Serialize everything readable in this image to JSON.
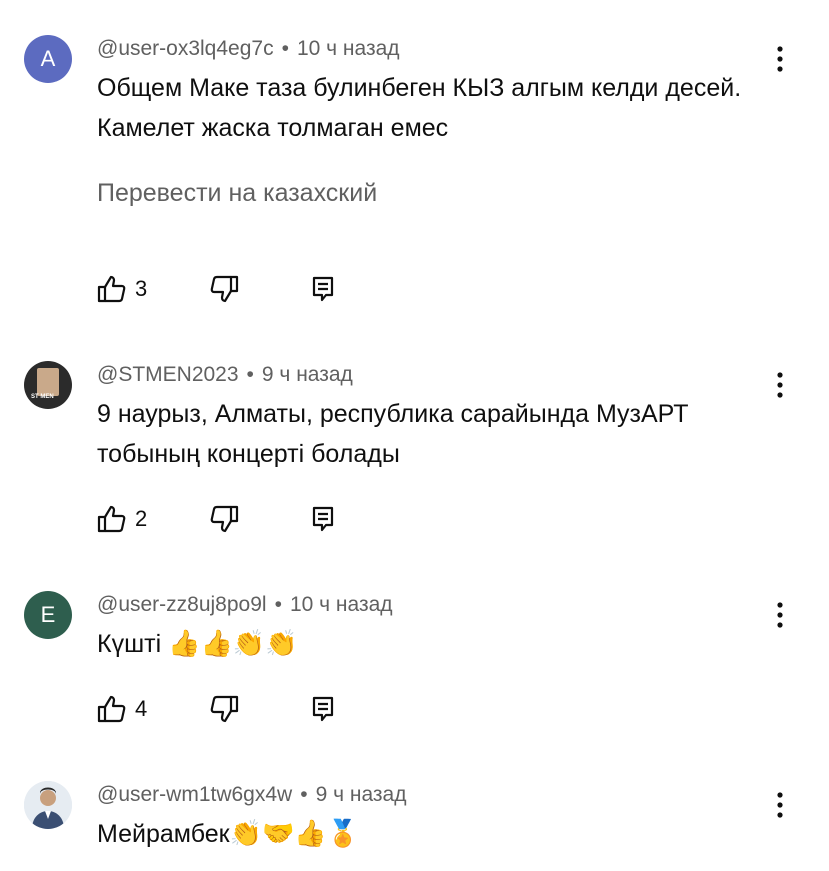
{
  "comments": [
    {
      "avatar_letter": "A",
      "avatar_color": "#5c6bc0",
      "author": "@user-ox3lq4eg7c",
      "time": "10 ч назад",
      "text": "Общем Маке таза булинбеген КЫЗ алгым келди десей. Камелет жаска толмаган емес",
      "translate": "Перевести на казахский",
      "likes": "3"
    },
    {
      "avatar_letter": "ST MEN",
      "avatar_color": "#2b2b2b",
      "author": "@STMEN2023",
      "time": "9 ч назад",
      "text": "9 наурыз, Алматы, республика сарайында МузАРТ тобының концерті болады",
      "likes": "2"
    },
    {
      "avatar_letter": "E",
      "avatar_color": "#2e5e4e",
      "author": "@user-zz8uj8po9l",
      "time": "10 ч назад",
      "text": "Күшті",
      "emojis": "👍👍👏👏",
      "likes": "4"
    },
    {
      "avatar_letter": "",
      "avatar_color": "#dfe6ee",
      "author": "@user-wm1tw6gx4w",
      "time": "9 ч назад",
      "text": "Мейрамбек",
      "emojis": "👏🤝👍🏅"
    }
  ],
  "icons": {
    "like": "thumb-up-icon",
    "dislike": "thumb-down-icon",
    "reply": "reply-icon",
    "menu": "more-vert-icon"
  }
}
